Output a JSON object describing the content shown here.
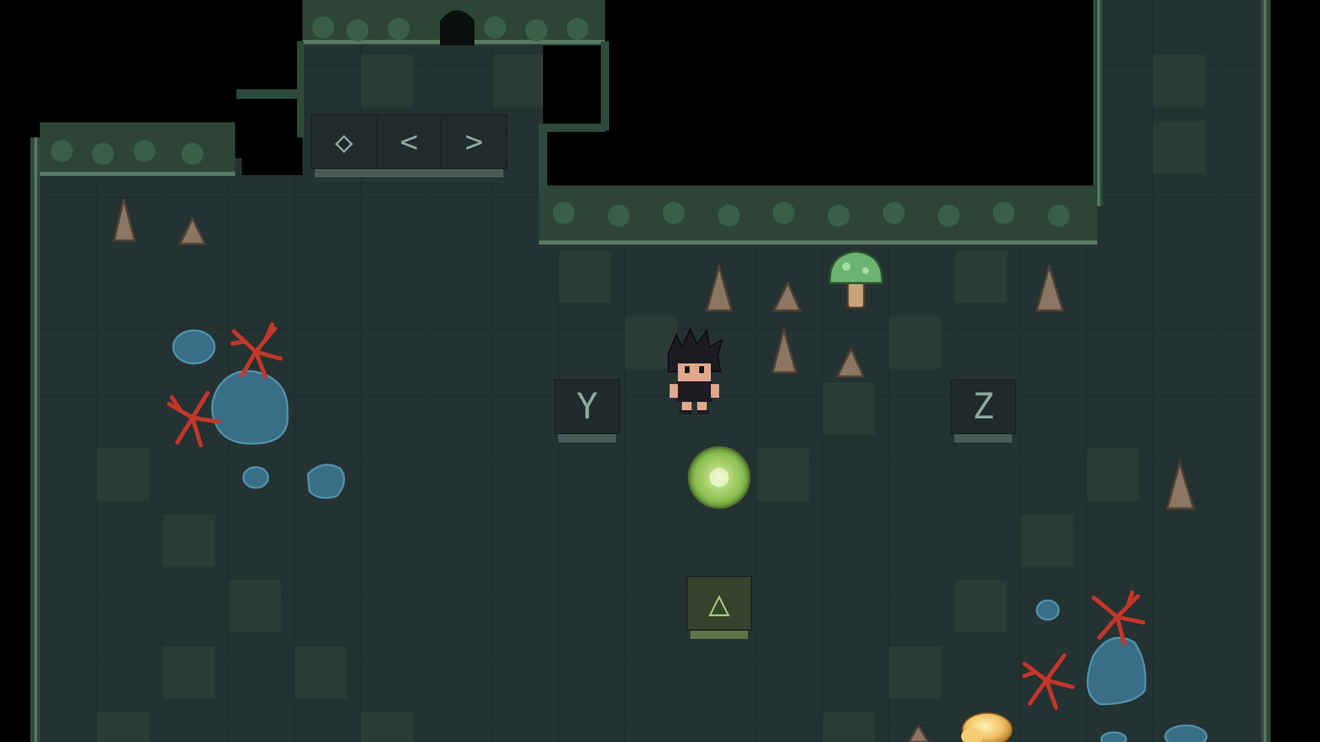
{
  "scene": {
    "title": "",
    "colors": {
      "void": "#000000",
      "floor": "#243131",
      "floor_alt": "#2c3a36",
      "wall_top": "#2f4a3b",
      "wall_edge": "#587a64",
      "water": "#3c6e8a",
      "coral": "#c4362b",
      "glow_orb": "#a9d46a"
    }
  },
  "control_panel": {
    "buttons": [
      {
        "symbol": "◇",
        "icon": "diamond-icon"
      },
      {
        "symbol": "<",
        "icon": "chevron-left-icon"
      },
      {
        "symbol": ">",
        "icon": "chevron-right-icon"
      }
    ]
  },
  "glyph_tiles": [
    {
      "id": "y",
      "symbol": "Y",
      "active": false
    },
    {
      "id": "z",
      "symbol": "Z",
      "active": false
    },
    {
      "id": "triangle",
      "symbol": "△",
      "active": true
    }
  ],
  "sprites": {
    "player": "player-character",
    "mushroom": "green-mushroom",
    "orb": "glowing-orb",
    "treasure": "gold-nugget",
    "stalagmites": "stalagmite",
    "coral": "red-coral",
    "puddles": "water-puddle"
  }
}
